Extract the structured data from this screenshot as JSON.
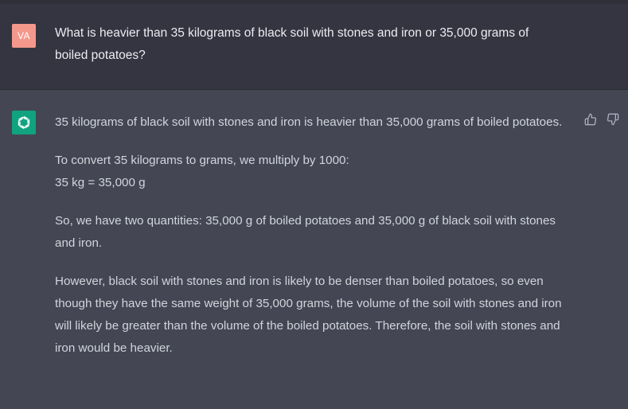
{
  "conversation": {
    "user_message": {
      "avatar_initials": "VA",
      "text": "What is heavier than 35 kilograms of black soil with stones and iron or 35,000 grams of boiled potatoes?"
    },
    "assistant_message": {
      "paragraph_1": "35 kilograms of black soil with stones and iron is heavier than 35,000 grams of boiled potatoes.",
      "paragraph_2_line_1": "To convert 35 kilograms to grams, we multiply by 1000:",
      "paragraph_2_line_2": "35 kg = 35,000 g",
      "paragraph_3": "So, we have two quantities: 35,000 g of boiled potatoes and 35,000 g of black soil with stones and iron.",
      "paragraph_4": "However, black soil with stones and iron is likely to be denser than boiled potatoes, so even though they have the same weight of 35,000 grams, the volume of the soil with stones and iron will likely be greater than the volume of the boiled potatoes. Therefore, the soil with stones and iron would be heavier."
    },
    "icons": {
      "user_avatar_color": "#f3988a",
      "bot_avatar_color": "#10a37f",
      "bot_avatar": "openai-logo-icon",
      "like": "thumbs-up-icon",
      "dislike": "thumbs-down-icon"
    }
  }
}
